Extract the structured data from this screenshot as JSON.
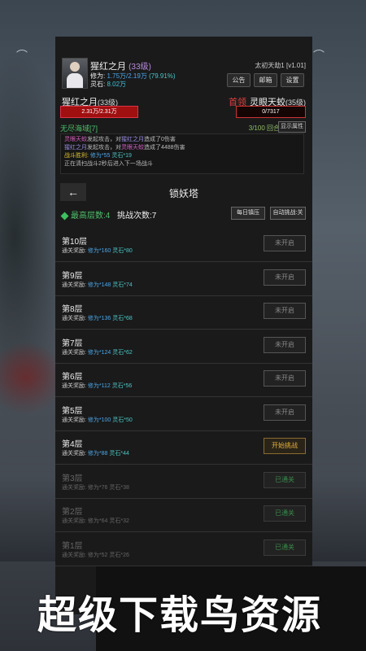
{
  "player": {
    "name": "猩红之月",
    "level": "(33级)",
    "cultivation_label": "修为:",
    "cultivation_value": "1.75万/2.19万",
    "cultivation_pct": "(79.91%)",
    "spirit_stone_label": "灵石:",
    "spirit_stone_value": "8.02万"
  },
  "header": {
    "version": "太初天劫1 [v1.01]",
    "buttons": [
      "公告",
      "邮箱",
      "设置"
    ]
  },
  "battle": {
    "left_name": "猩红之月",
    "left_level": "(33级)",
    "left_hp": "2.31万/2.31万",
    "boss_tag": "首领",
    "right_name": "灵眼天蛟",
    "right_level": "(35级)",
    "right_hp": "0/7317",
    "area": "无尽海域[7]",
    "rounds": "3/100 回合",
    "show_attr": "显示属性"
  },
  "log": {
    "line1_a": "灵眼天蛟",
    "line1_b": "发起攻击，对",
    "line1_c": "猩红之月",
    "line1_d": "造成了0伤害",
    "line2_a": "猩红之月",
    "line2_b": "发起攻击，对",
    "line2_c": "灵眼天蛟",
    "line2_d": "造成了4488伤害",
    "line3_a": "战斗胜利:",
    "line3_b": "修为*55",
    "line3_c": "灵石*19",
    "line4": "正在清扫战斗2秒后进入下一场战斗"
  },
  "tower": {
    "back_icon": "←",
    "title": "锁妖塔",
    "max_floor": "最高层数:4",
    "challenges": "挑战次数:7",
    "daily_btn": "每日镇压",
    "auto_btn": "自动挑战:关",
    "reward_label": "通关奖励:",
    "floors": [
      {
        "name": "第10层",
        "cult": "修为*160",
        "stone": "灵石*80",
        "btn": "未开启",
        "state": "locked"
      },
      {
        "name": "第9层",
        "cult": "修为*148",
        "stone": "灵石*74",
        "btn": "未开启",
        "state": "locked"
      },
      {
        "name": "第8层",
        "cult": "修为*136",
        "stone": "灵石*68",
        "btn": "未开启",
        "state": "locked"
      },
      {
        "name": "第7层",
        "cult": "修为*124",
        "stone": "灵石*62",
        "btn": "未开启",
        "state": "locked"
      },
      {
        "name": "第6层",
        "cult": "修为*112",
        "stone": "灵石*56",
        "btn": "未开启",
        "state": "locked"
      },
      {
        "name": "第5层",
        "cult": "修为*100",
        "stone": "灵石*50",
        "btn": "未开启",
        "state": "locked"
      },
      {
        "name": "第4层",
        "cult": "修为*88",
        "stone": "灵石*44",
        "btn": "开始挑战",
        "state": "active"
      },
      {
        "name": "第3层",
        "cult": "修为*76",
        "stone": "灵石*38",
        "btn": "已通关",
        "state": "done"
      },
      {
        "name": "第2层",
        "cult": "修为*64",
        "stone": "灵石*32",
        "btn": "已通关",
        "state": "done"
      },
      {
        "name": "第1层",
        "cult": "修为*52",
        "stone": "灵石*26",
        "btn": "已通关",
        "state": "done"
      }
    ]
  },
  "watermark": "超级下载鸟资源",
  "colors": {
    "accent_green": "#4fbf6a",
    "boss_red": "#e04040",
    "active_gold": "#e7b13a"
  }
}
